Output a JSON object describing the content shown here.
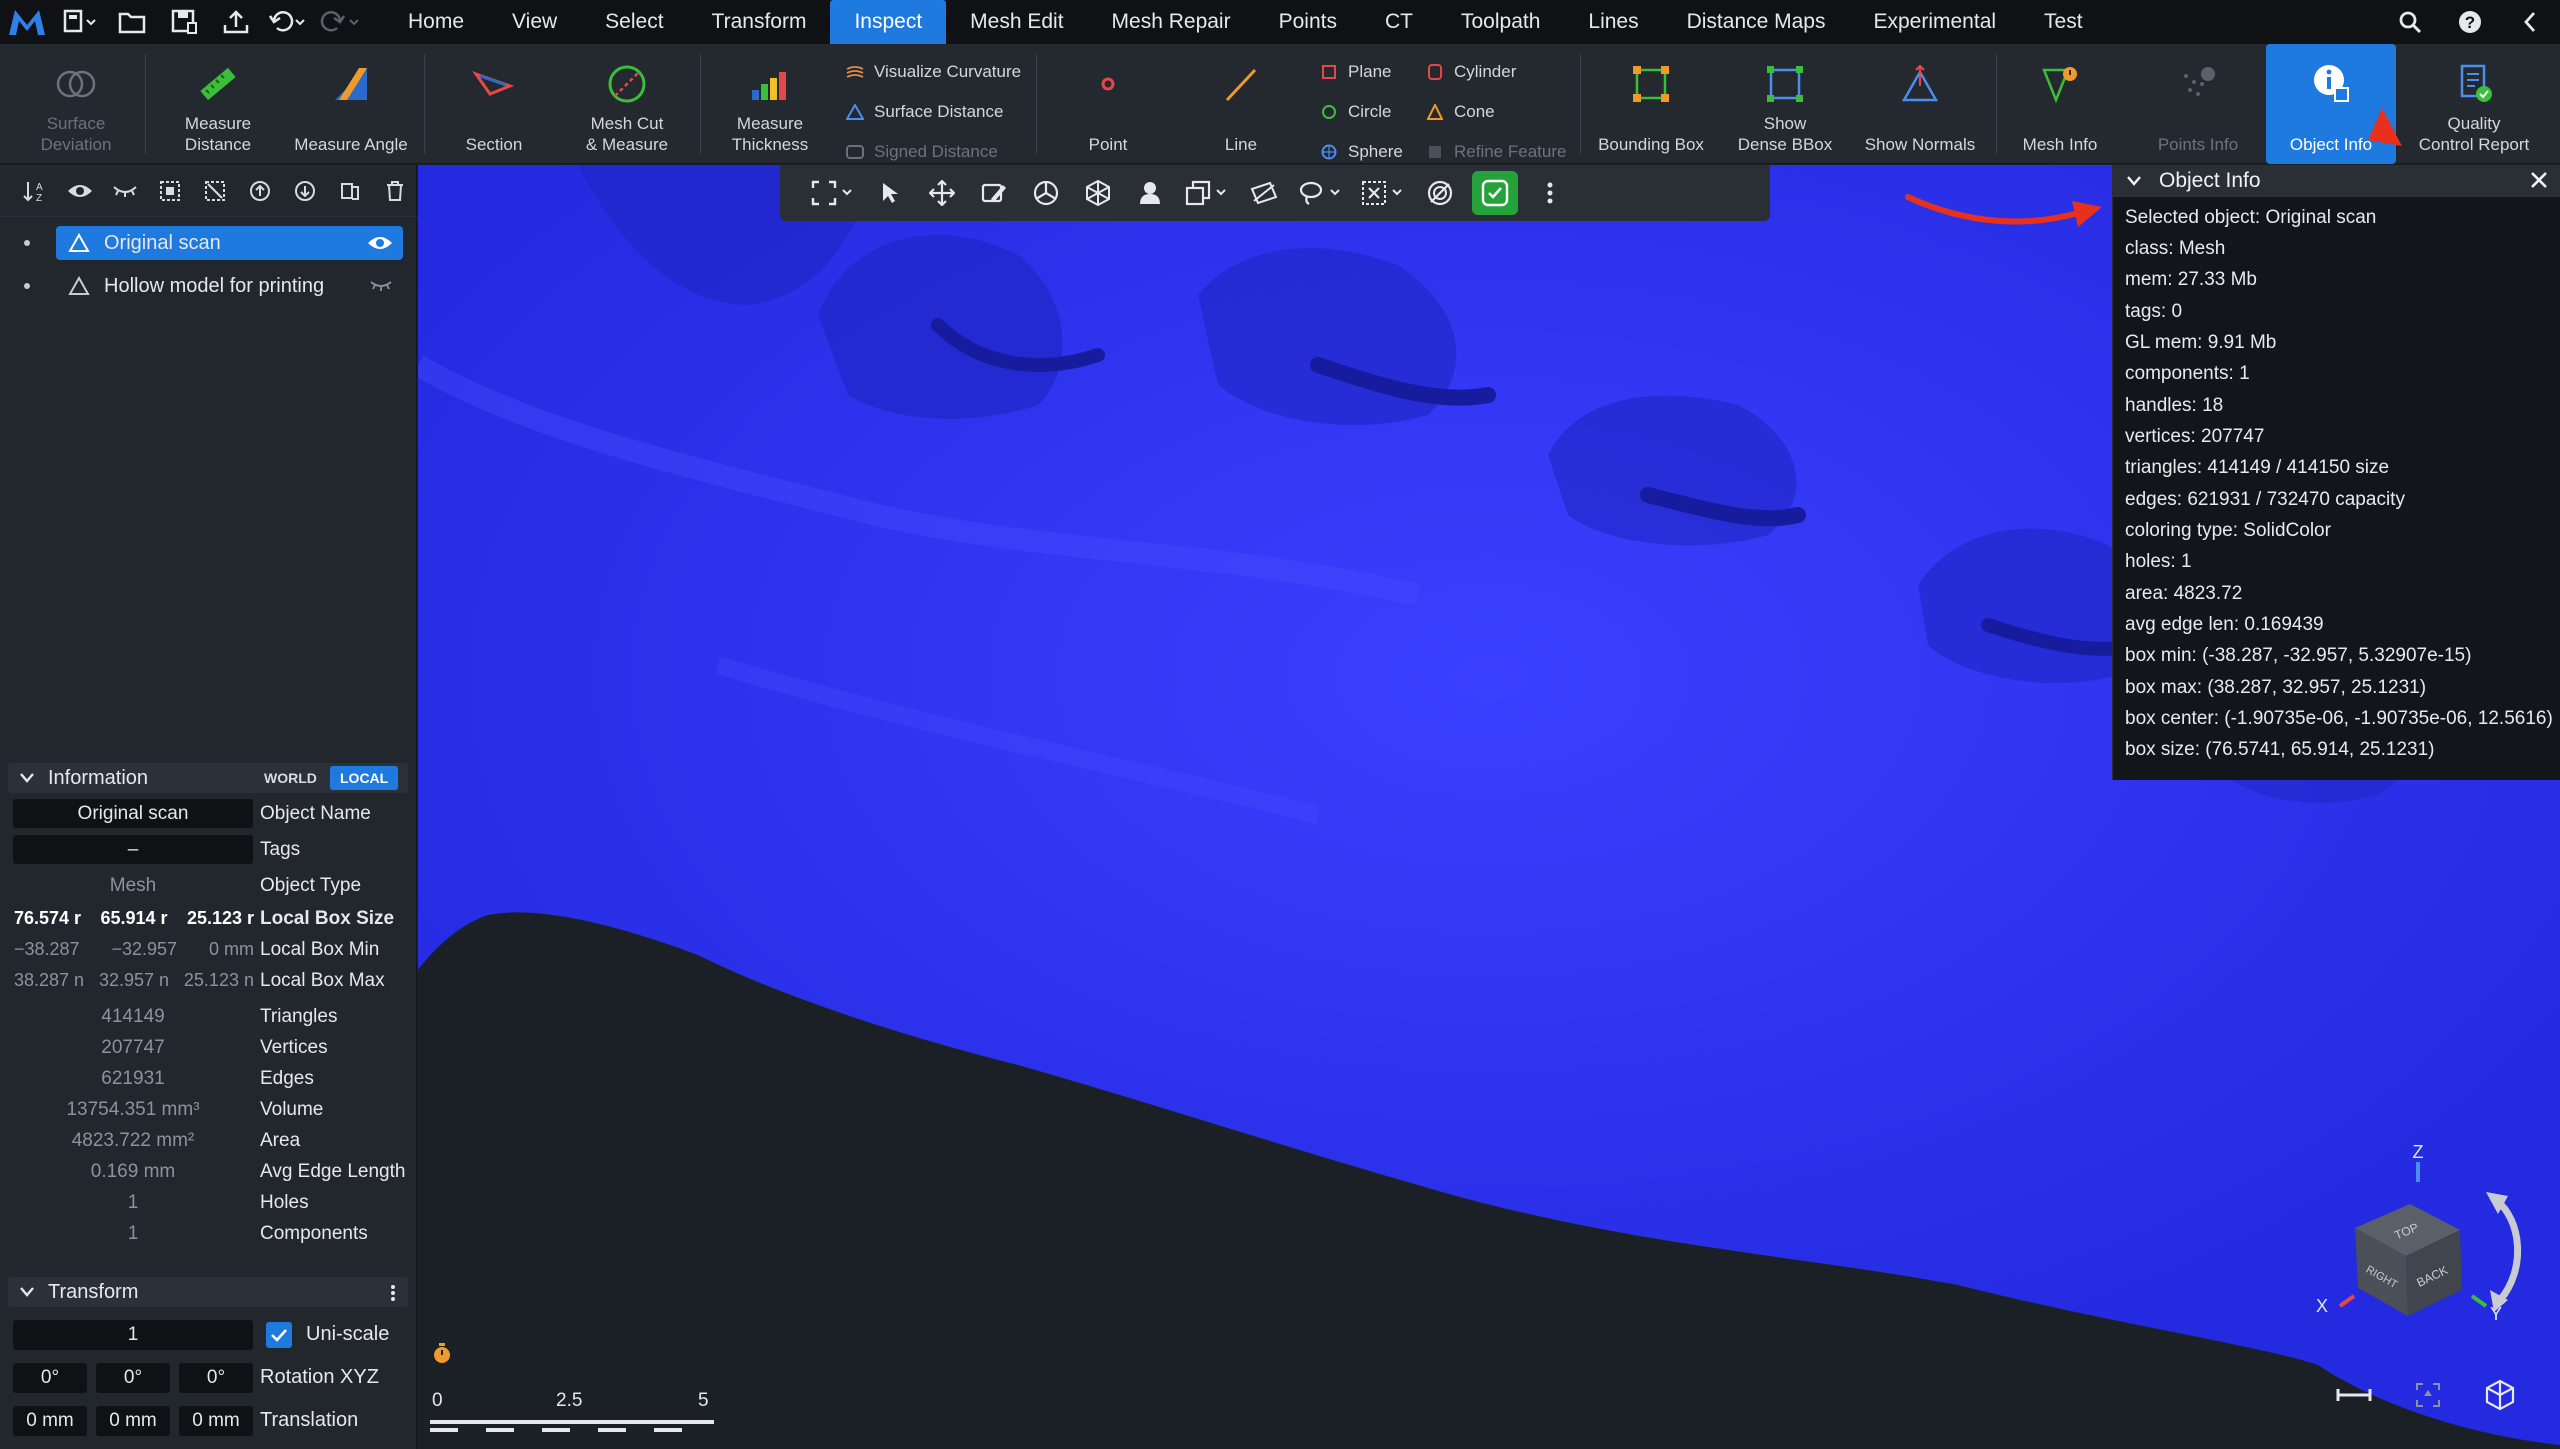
{
  "menubar": {
    "tabs": [
      "Home",
      "View",
      "Select",
      "Transform",
      "Inspect",
      "Mesh Edit",
      "Mesh Repair",
      "Points",
      "CT",
      "Toolpath",
      "Lines",
      "Distance Maps",
      "Experimental",
      "Test"
    ],
    "active_tab": "Inspect"
  },
  "ribbon": {
    "surface_deviation": "Surface\nDeviation",
    "measure_distance": "Measure\nDistance",
    "measure_angle": "Measure Angle",
    "section": "Section",
    "mesh_cut_measure": "Mesh Cut\n& Measure",
    "measure_thickness": "Measure\nThickness",
    "visualize_curvature": "Visualize Curvature",
    "surface_distance": "Surface Distance",
    "signed_distance": "Signed Distance",
    "point": "Point",
    "line": "Line",
    "plane": "Plane",
    "circle": "Circle",
    "sphere": "Sphere",
    "cylinder": "Cylinder",
    "cone": "Cone",
    "refine_feature": "Refine Feature",
    "bounding_box": "Bounding Box",
    "show_dense_bbox": "Show\nDense BBox",
    "show_normals": "Show Normals",
    "mesh_info": "Mesh Info",
    "points_info": "Points Info",
    "object_info": "Object Info",
    "quality_control_report": "Quality\nControl Report"
  },
  "scene": {
    "items": [
      {
        "name": "Original scan",
        "selected": true,
        "visible": true
      },
      {
        "name": "Hollow model for printing",
        "selected": false,
        "visible": false
      }
    ]
  },
  "information": {
    "title": "Information",
    "world_label": "WORLD",
    "local_label": "LOCAL",
    "object_name": "Original scan",
    "object_name_key": "Object Name",
    "tags": "–",
    "tags_key": "Tags",
    "object_type": "Mesh",
    "object_type_key": "Object Type",
    "local_box_size": [
      "76.574 r",
      "65.914 r",
      "25.123 r"
    ],
    "local_box_size_key": "Local Box Size",
    "local_box_min": [
      "−38.287",
      "−32.957",
      "0 mm"
    ],
    "local_box_min_key": "Local Box Min",
    "local_box_max": [
      "38.287 n",
      "32.957 n",
      "25.123 n"
    ],
    "local_box_max_key": "Local Box Max",
    "triangles": "414149",
    "triangles_key": "Triangles",
    "vertices": "207747",
    "vertices_key": "Vertices",
    "edges": "621931",
    "edges_key": "Edges",
    "volume": "13754.351 mm³",
    "volume_key": "Volume",
    "area": "4823.722 mm²",
    "area_key": "Area",
    "avg_edge": "0.169 mm",
    "avg_edge_key": "Avg Edge Length",
    "holes": "1",
    "holes_key": "Holes",
    "components": "1",
    "components_key": "Components"
  },
  "transform": {
    "title": "Transform",
    "scale": "1",
    "uniscale_label": "Uni-scale",
    "rotation": [
      "0°",
      "0°",
      "0°"
    ],
    "rotation_key": "Rotation XYZ",
    "translation": [
      "0 mm",
      "0 mm",
      "0 mm"
    ],
    "translation_key": "Translation"
  },
  "object_info": {
    "title": "Object Info",
    "lines": [
      "Selected object: Original scan",
      "class: Mesh",
      "mem: 27.33 Mb",
      "tags: 0",
      "GL mem: 9.91 Mb",
      "components: 1",
      "handles: 18",
      "vertices: 207747",
      "triangles: 414149 / 414150 size",
      "edges: 621931 / 732470 capacity",
      "coloring type: SolidColor",
      "holes: 1",
      "area: 4823.72",
      "avg edge len: 0.169439",
      "box min: (-38.287, -32.957, 5.32907e-15)",
      "box max: (38.287, 32.957, 25.1231)",
      "box center: (-1.90735e-06, -1.90735e-06, 12.5616)",
      "box size: (76.5741, 65.914, 25.1231)"
    ]
  },
  "scale_bar": {
    "labels": [
      "0",
      "2.5",
      "5"
    ]
  },
  "view_cube": {
    "top": "TOP",
    "right": "RIGHT",
    "back": "BACK",
    "axis_x": "X",
    "axis_y": "Y",
    "axis_z": "Z"
  },
  "colors": {
    "accent": "#1f7ae0",
    "mesh": "#2b31f3",
    "background": "#1b1f26",
    "annotation_arrow": "#e8311c"
  }
}
